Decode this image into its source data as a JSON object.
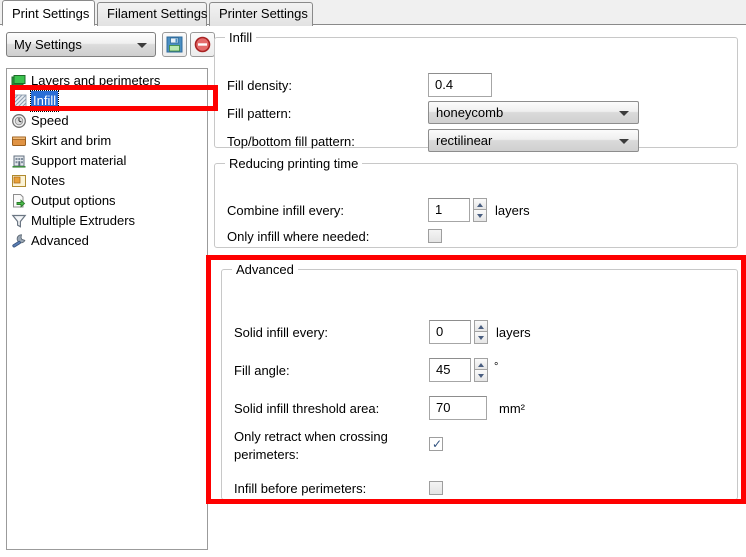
{
  "window": {
    "tabs": [
      {
        "label": "Print Settings",
        "active": true
      },
      {
        "label": "Filament Settings",
        "active": false
      },
      {
        "label": "Printer Settings",
        "active": false
      }
    ]
  },
  "toolbar": {
    "preset_value": "My Settings",
    "save_icon": "floppy-save-icon",
    "delete_icon": "delete-preset-icon"
  },
  "sidebar": {
    "items": [
      {
        "label": "Layers and perimeters",
        "icon": "layers-icon",
        "selected": false
      },
      {
        "label": "Infill",
        "icon": "infill-hatch-icon",
        "selected": true
      },
      {
        "label": "Speed",
        "icon": "clock-icon",
        "selected": false
      },
      {
        "label": "Skirt and brim",
        "icon": "box-icon",
        "selected": false
      },
      {
        "label": "Support material",
        "icon": "building-icon",
        "selected": false
      },
      {
        "label": "Notes",
        "icon": "note-icon",
        "selected": false
      },
      {
        "label": "Output options",
        "icon": "export-arrow-icon",
        "selected": false
      },
      {
        "label": "Multiple Extruders",
        "icon": "funnel-icon",
        "selected": false
      },
      {
        "label": "Advanced",
        "icon": "wrench-icon",
        "selected": false
      }
    ]
  },
  "groups": {
    "infill": {
      "legend": "Infill",
      "fill_density": {
        "label": "Fill density:",
        "value": "0.4"
      },
      "fill_pattern": {
        "label": "Fill pattern:",
        "value": "honeycomb"
      },
      "top_bottom_fill_pattern": {
        "label": "Top/bottom fill pattern:",
        "value": "rectilinear"
      }
    },
    "reducing": {
      "legend": "Reducing printing time",
      "combine_infill_every": {
        "label": "Combine infill every:",
        "value": "1",
        "unit": "layers"
      },
      "only_infill_where_needed": {
        "label": "Only infill where needed:",
        "checked": false
      }
    },
    "advanced": {
      "legend": "Advanced",
      "solid_infill_every": {
        "label": "Solid infill every:",
        "value": "0",
        "unit": "layers"
      },
      "fill_angle": {
        "label": "Fill angle:",
        "value": "45",
        "unit": "°"
      },
      "solid_infill_threshold_area": {
        "label": "Solid infill threshold area:",
        "value": "70",
        "unit": "mm²"
      },
      "only_retract_when_crossing_perimeters": {
        "label_line1": "Only retract when crossing",
        "label_line2": "perimeters:",
        "checked": true
      },
      "infill_before_perimeters": {
        "label": "Infill before perimeters:",
        "checked": false
      }
    }
  },
  "annotations": {
    "highlight_color": "#fe0000",
    "boxes": [
      {
        "name": "highlight-infill-tree-item"
      },
      {
        "name": "highlight-advanced-group"
      }
    ]
  }
}
